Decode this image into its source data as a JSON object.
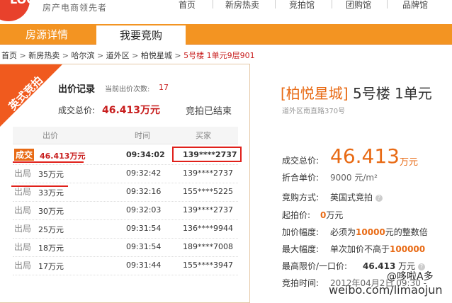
{
  "header": {
    "logo_text": "LOG",
    "slogan": "房产电商领先者",
    "nav": [
      "首页",
      "新房热卖",
      "竞拍馆",
      "团购馆",
      "品牌馆"
    ]
  },
  "tabs": {
    "tab1": "房源详情",
    "tab2": "我要竞购"
  },
  "breadcrumb": {
    "items": [
      "首页",
      "新房热卖",
      "哈尔滨",
      "道外区",
      "柏悦星城"
    ],
    "sep": ">",
    "current": "5号楼  1单元9层901"
  },
  "ribbon": "英式竞拍",
  "record": {
    "title": "出价记录",
    "count_label": "当前出价次数:",
    "count": "17",
    "deal_label": "成交总价:",
    "deal_value": "46.413万元",
    "status": "竞拍已结束",
    "headers": {
      "price": "出价",
      "time": "时间",
      "buyer": "买家"
    },
    "rows": [
      {
        "badge": "成交",
        "price": "46.413万元",
        "time": "09:34:02",
        "buyer": "139****2737",
        "win": true
      },
      {
        "badge": "出局",
        "price": "35万元",
        "time": "09:32:42",
        "buyer": "139****2737"
      },
      {
        "badge": "出局",
        "price": "33万元",
        "time": "09:32:16",
        "buyer": "155****5225"
      },
      {
        "badge": "出局",
        "price": "30万元",
        "time": "09:32:03",
        "buyer": "139****2737"
      },
      {
        "badge": "出局",
        "price": "25万元",
        "time": "09:31:54",
        "buyer": "136****9944"
      },
      {
        "badge": "出局",
        "price": "18万元",
        "time": "09:31:54",
        "buyer": "189****7008"
      },
      {
        "badge": "出局",
        "price": "17万元",
        "time": "09:31:44",
        "buyer": "155****3947"
      }
    ]
  },
  "detail": {
    "project": "[柏悦星城]",
    "unit": "5号楼 1单元",
    "address": "道外区南直路370号",
    "total_label": "成交总价:",
    "total_value": "46.413",
    "total_unit": "万元",
    "unit_price_label": "折合单价:",
    "unit_price": "9000 元/m²",
    "mode_label": "竞购方式:",
    "mode": "英国式竞拍",
    "start_label": "起拍价:",
    "start_value": "0",
    "start_unit": "万元",
    "inc_label": "加价幅度:",
    "inc_pre": "必须为",
    "inc_value": "10000",
    "inc_post": "元的整数倍",
    "max_label": "最大幅度:",
    "max_pre": "单次加价不高于",
    "max_value": "100000",
    "maxprice_label": "最高限价/一口价:",
    "maxprice_value": "46.413",
    "maxprice_unit": "万元",
    "time_label": "竞拍时间:",
    "time_value": "2012年04月2日  09:30 -"
  },
  "watermark": {
    "line1": "@哆啦A多",
    "line2": "weibo.com/limaojun"
  }
}
